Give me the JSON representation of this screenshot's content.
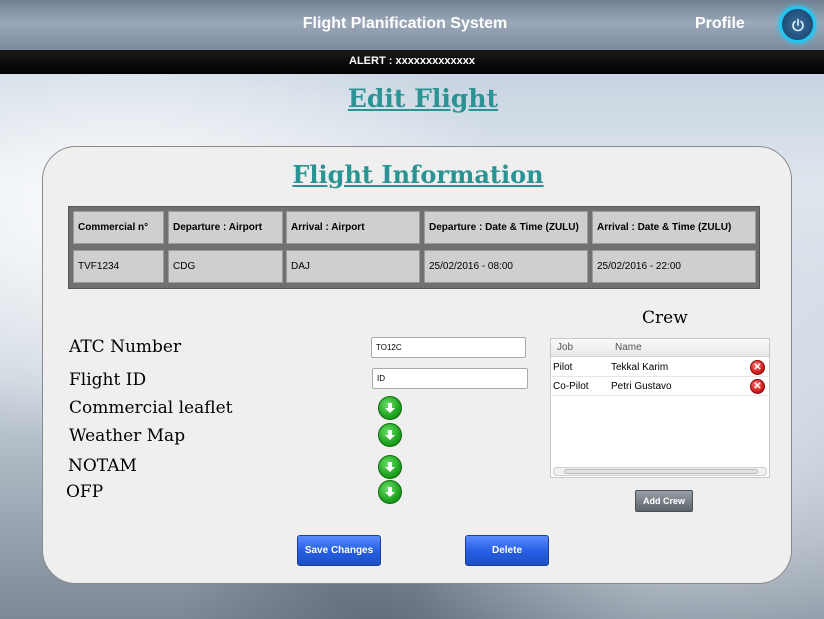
{
  "header": {
    "title": "Flight Planification System",
    "profile_label": "Profile",
    "power_icon": "power-icon",
    "alert_text": "ALERT : xxxxxxxxxxxxx"
  },
  "page": {
    "title": "Edit Flight"
  },
  "flight_info": {
    "title": "Flight Information",
    "columns": [
      "Commercial n°",
      "Departure : Airport",
      "Arrival : Airport",
      "Departure : Date & Time (ZULU)",
      "Arrival : Date & Time (ZULU)"
    ],
    "row": [
      "TVF1234",
      "CDG",
      "DAJ",
      "25/02/2016 - 08:00",
      "25/02/2016 - 22:00"
    ]
  },
  "form": {
    "atc_label": "ATC Number",
    "atc_value": "TO12C",
    "flight_id_label": "Flight ID",
    "flight_id_value": "ID",
    "commercial_leaflet_label": "Commercial leaflet",
    "weather_map_label": "Weather Map",
    "notam_label": "NOTAM",
    "ofp_label": "OFP",
    "download_icon": "download-icon"
  },
  "crew": {
    "title": "Crew",
    "columns": [
      "Job",
      "Name"
    ],
    "members": [
      {
        "job": "Pilot",
        "name": "Tekkal Karim"
      },
      {
        "job": "Co-Pilot",
        "name": "Petri Gustavo"
      }
    ],
    "add_button": "Add Crew",
    "remove_icon": "remove-icon"
  },
  "actions": {
    "save_label": "Save Changes",
    "delete_label": "Delete"
  },
  "colors": {
    "title_teal": "#2a9393",
    "button_blue": "#2760e6",
    "download_green": "#1ea41e",
    "remove_red": "#d21e1e"
  }
}
